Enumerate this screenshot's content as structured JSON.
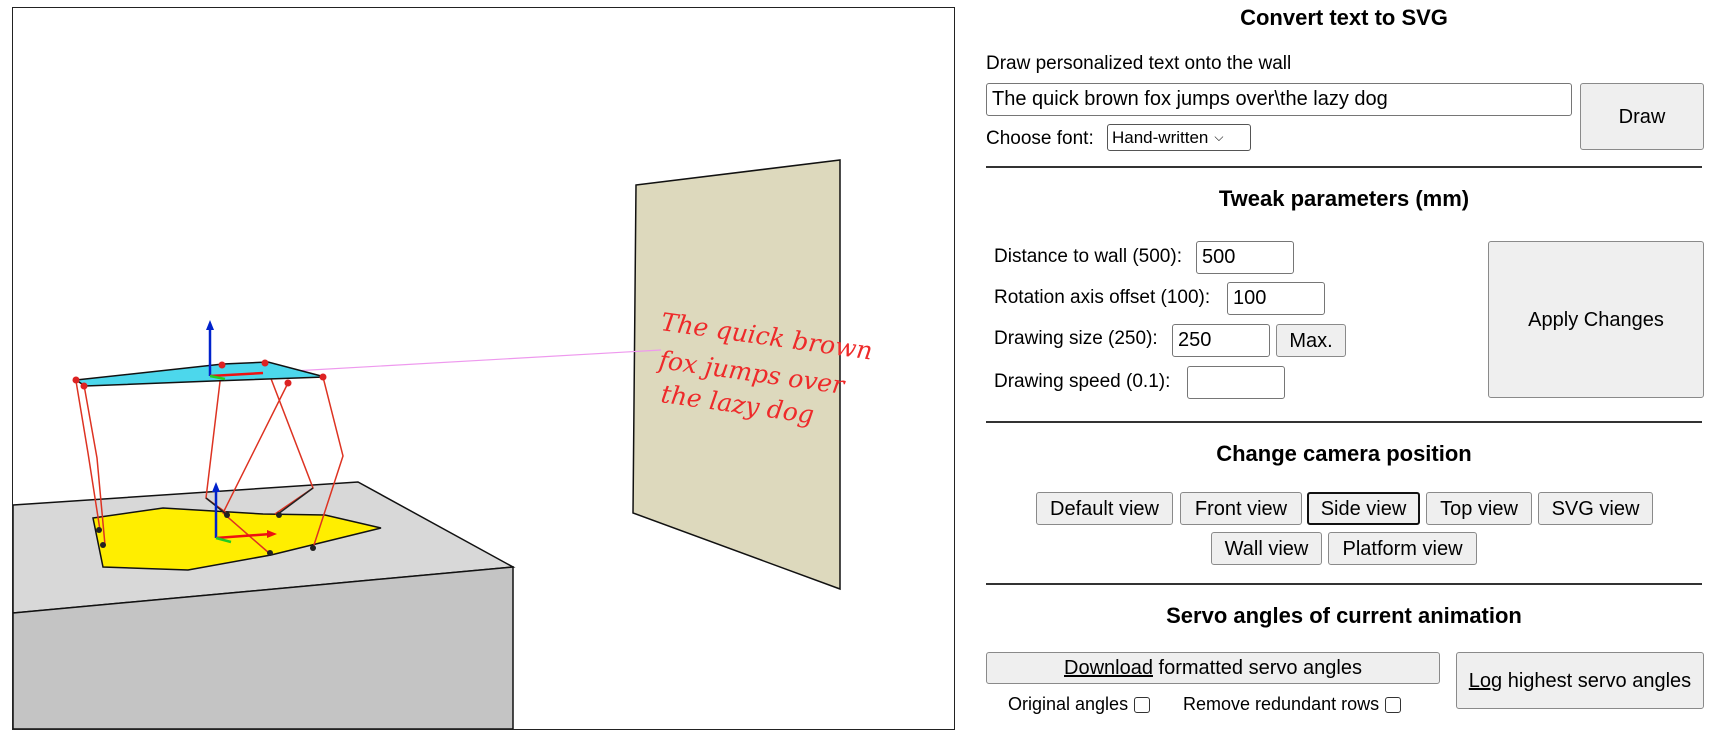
{
  "convert": {
    "title": "Convert text to SVG",
    "description": "Draw personalized text onto the wall",
    "text_value": "The quick brown fox jumps over\\the lazy dog",
    "draw_label": "Draw",
    "font_label": "Choose font:",
    "font_selected": "Hand-written"
  },
  "tweak": {
    "title": "Tweak parameters (mm)",
    "distance_label": "Distance to wall (500):",
    "distance_value": "500",
    "rotation_label": "Rotation axis offset (100):",
    "rotation_value": "100",
    "size_label": "Drawing size (250):",
    "size_value": "250",
    "max_label": "Max.",
    "speed_label": "Drawing speed (0.1):",
    "speed_value": "",
    "apply_label": "Apply Changes"
  },
  "camera": {
    "title": "Change camera position",
    "views": [
      "Default view",
      "Front view",
      "Side view",
      "Top view",
      "SVG view",
      "Wall view",
      "Platform view"
    ],
    "active_view": "Side view"
  },
  "servo": {
    "title": "Servo angles of current animation",
    "download_link": "Download",
    "download_rest": " formatted servo angles",
    "log_link": "Log",
    "log_rest": " highest servo angles",
    "original_label": "Original angles",
    "remove_label": "Remove redundant rows"
  },
  "scene": {
    "wall_text": [
      "The quick brown",
      "fox jumps over",
      "the lazy dog"
    ],
    "colors": {
      "wall": "#ddd9bd",
      "platform_top": "#4cd7ec",
      "platform_base": "#ffee00",
      "table_top": "#d8d8d8",
      "table_side": "#c4c4c4",
      "rods": "#dd3322",
      "laser": "#ee99ee",
      "axis_blue": "#0022cc",
      "axis_red": "#ee1111",
      "axis_green": "#22cc22"
    }
  }
}
